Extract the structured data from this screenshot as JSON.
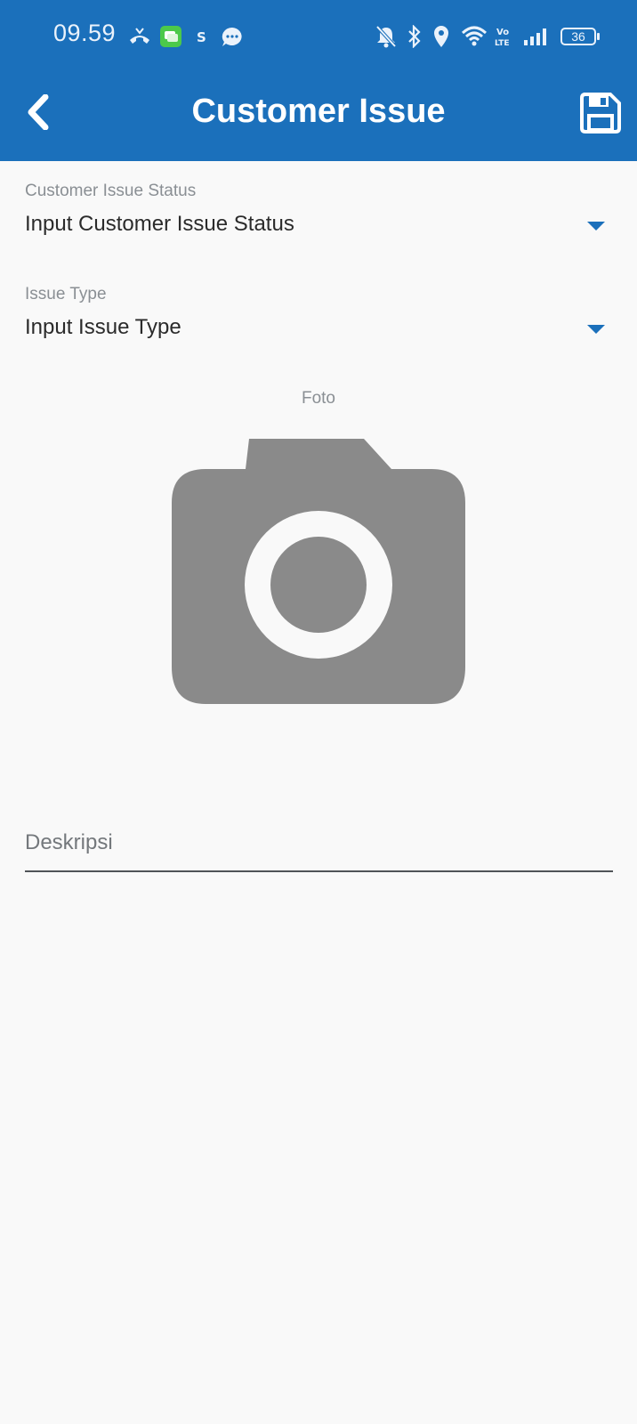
{
  "status_bar": {
    "time": "09.59",
    "battery": "36",
    "icons": [
      "missed-call-icon",
      "messages-app-icon",
      "s-app-icon",
      "chat-bubble-icon",
      "mute-bell-icon",
      "bluetooth-icon",
      "location-icon",
      "wifi-icon",
      "volte-icon",
      "signal-icon",
      "battery-icon"
    ]
  },
  "header": {
    "title": "Customer Issue",
    "back_icon": "chevron-left-icon",
    "save_icon": "floppy-disk-icon",
    "background": "#1b70bb"
  },
  "form": {
    "status": {
      "label": "Customer Issue Status",
      "value": "Input Customer Issue Status"
    },
    "issue_type": {
      "label": "Issue Type",
      "value": "Input Issue Type"
    },
    "foto": {
      "label": "Foto",
      "icon": "camera-icon"
    },
    "description": {
      "placeholder": "Deskripsi",
      "value": ""
    }
  },
  "colors": {
    "accent": "#1b70bb",
    "camera_gray": "#8a8a8a",
    "background": "#f9f9f9"
  }
}
